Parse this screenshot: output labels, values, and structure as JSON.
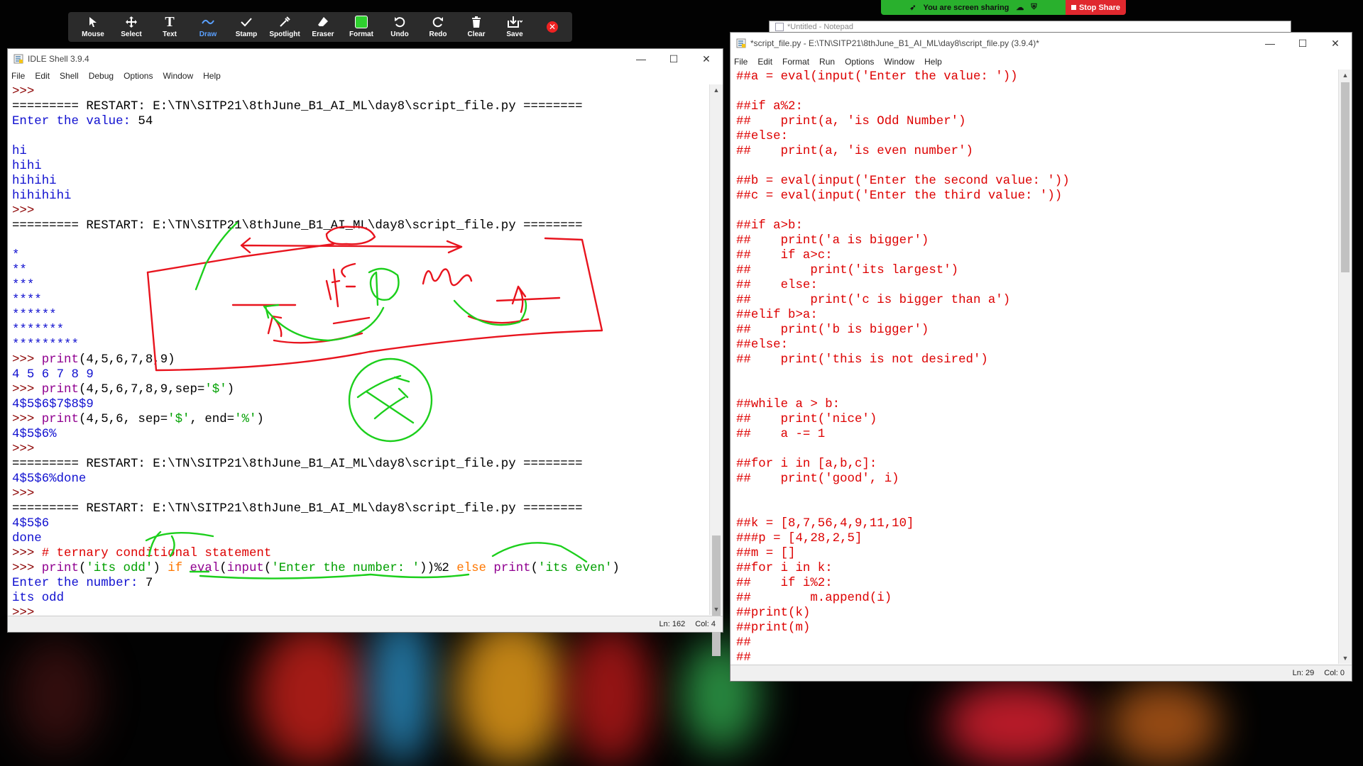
{
  "colors": {
    "shell_output": "#1010d0",
    "keyword": "#ff7700",
    "builtin": "#900090",
    "string": "#00a000",
    "comment": "#dd0000",
    "annotation_red": "#e8141e",
    "annotation_green": "#1ccf1c"
  },
  "zoom_toolbar": {
    "buttons": [
      {
        "label": "Mouse",
        "icon": "cursor-icon"
      },
      {
        "label": "Select",
        "icon": "move-icon"
      },
      {
        "label": "Text",
        "icon": "text-icon"
      },
      {
        "label": "Draw",
        "icon": "draw-icon",
        "active": true
      },
      {
        "label": "Stamp",
        "icon": "check-stamp-icon"
      },
      {
        "label": "Spotlight",
        "icon": "spotlight-icon"
      },
      {
        "label": "Eraser",
        "icon": "eraser-icon"
      },
      {
        "label": "Format",
        "icon": "format-icon"
      },
      {
        "label": "Undo",
        "icon": "undo-icon"
      },
      {
        "label": "Redo",
        "icon": "redo-icon"
      },
      {
        "label": "Clear",
        "icon": "trash-icon"
      },
      {
        "label": "Save",
        "icon": "save-icon"
      }
    ]
  },
  "share_banner": {
    "sharing_text": "You are screen sharing",
    "stop_label": "Stop Share"
  },
  "notepad_back": {
    "title": "*Untitled - Notepad"
  },
  "idle_shell": {
    "title": "IDLE Shell 3.9.4",
    "menu": [
      "File",
      "Edit",
      "Shell",
      "Debug",
      "Options",
      "Window",
      "Help"
    ],
    "status": {
      "line": "Ln: 162",
      "col": "Col: 4"
    },
    "lines": [
      [
        {
          "t": ">>>",
          "c": "c-prompt"
        }
      ],
      [
        {
          "t": "========= RESTART: E:\\TN\\SITP21\\8thJune_B1_AI_ML\\day8\\script_file.py ========",
          "c": ""
        }
      ],
      [
        {
          "t": "Enter the value: ",
          "c": "c-out"
        },
        {
          "t": "54",
          "c": ""
        }
      ],
      [],
      [
        {
          "t": "hi",
          "c": "c-out"
        }
      ],
      [
        {
          "t": "hihi",
          "c": "c-out"
        }
      ],
      [
        {
          "t": "hihihi",
          "c": "c-out"
        }
      ],
      [
        {
          "t": "hihihihi",
          "c": "c-out"
        }
      ],
      [
        {
          "t": ">>>",
          "c": "c-prompt"
        }
      ],
      [
        {
          "t": "========= RESTART: E:\\TN\\SITP21\\8thJune_B1_AI_ML\\day8\\script_file.py ========",
          "c": ""
        }
      ],
      [],
      [
        {
          "t": "*",
          "c": "c-out"
        }
      ],
      [
        {
          "t": "**",
          "c": "c-out"
        }
      ],
      [
        {
          "t": "***",
          "c": "c-out"
        }
      ],
      [
        {
          "t": "****",
          "c": "c-out"
        }
      ],
      [
        {
          "t": "******",
          "c": "c-out"
        }
      ],
      [
        {
          "t": "*******",
          "c": "c-out"
        }
      ],
      [
        {
          "t": "*********",
          "c": "c-out"
        }
      ],
      [
        {
          "t": ">>> ",
          "c": "c-prompt"
        },
        {
          "t": "print",
          "c": "c-bi"
        },
        {
          "t": "(4,5,6,7,8,9)",
          "c": ""
        }
      ],
      [
        {
          "t": "4 5 6 7 8 9",
          "c": "c-out"
        }
      ],
      [
        {
          "t": ">>> ",
          "c": "c-prompt"
        },
        {
          "t": "print",
          "c": "c-bi"
        },
        {
          "t": "(4,5,6,7,8,9,sep=",
          "c": ""
        },
        {
          "t": "'$'",
          "c": "c-str"
        },
        {
          "t": ")",
          "c": ""
        }
      ],
      [
        {
          "t": "4$5$6$7$8$9",
          "c": "c-out"
        }
      ],
      [
        {
          "t": ">>> ",
          "c": "c-prompt"
        },
        {
          "t": "print",
          "c": "c-bi"
        },
        {
          "t": "(4,5,6, sep=",
          "c": ""
        },
        {
          "t": "'$'",
          "c": "c-str"
        },
        {
          "t": ", end=",
          "c": ""
        },
        {
          "t": "'%'",
          "c": "c-str"
        },
        {
          "t": ")",
          "c": ""
        }
      ],
      [
        {
          "t": "4$5$6%",
          "c": "c-out"
        }
      ],
      [
        {
          "t": ">>>",
          "c": "c-prompt"
        }
      ],
      [
        {
          "t": "========= RESTART: E:\\TN\\SITP21\\8thJune_B1_AI_ML\\day8\\script_file.py ========",
          "c": ""
        }
      ],
      [
        {
          "t": "4$5$6%done",
          "c": "c-out"
        }
      ],
      [
        {
          "t": ">>>",
          "c": "c-prompt"
        }
      ],
      [
        {
          "t": "========= RESTART: E:\\TN\\SITP21\\8thJune_B1_AI_ML\\day8\\script_file.py ========",
          "c": ""
        }
      ],
      [
        {
          "t": "4$5$6",
          "c": "c-out"
        }
      ],
      [
        {
          "t": "done",
          "c": "c-out"
        }
      ],
      [
        {
          "t": ">>> ",
          "c": "c-prompt"
        },
        {
          "t": "# ternary conditional statement",
          "c": "c-cm"
        }
      ],
      [
        {
          "t": ">>> ",
          "c": "c-prompt"
        },
        {
          "t": "print",
          "c": "c-bi"
        },
        {
          "t": "(",
          "c": ""
        },
        {
          "t": "'its odd'",
          "c": "c-str"
        },
        {
          "t": ") ",
          "c": ""
        },
        {
          "t": "if",
          "c": "c-kw"
        },
        {
          "t": " ",
          "c": ""
        },
        {
          "t": "eval",
          "c": "c-bi"
        },
        {
          "t": "(",
          "c": ""
        },
        {
          "t": "input",
          "c": "c-bi"
        },
        {
          "t": "(",
          "c": ""
        },
        {
          "t": "'Enter the number: '",
          "c": "c-str"
        },
        {
          "t": "))%2 ",
          "c": ""
        },
        {
          "t": "else",
          "c": "c-kw"
        },
        {
          "t": " ",
          "c": ""
        },
        {
          "t": "print",
          "c": "c-bi"
        },
        {
          "t": "(",
          "c": ""
        },
        {
          "t": "'its even'",
          "c": "c-str"
        },
        {
          "t": ")",
          "c": ""
        }
      ],
      [
        {
          "t": "Enter the number: ",
          "c": "c-out"
        },
        {
          "t": "7",
          "c": ""
        }
      ],
      [
        {
          "t": "its odd",
          "c": "c-out"
        }
      ],
      [
        {
          "t": ">>> ",
          "c": "c-prompt"
        }
      ]
    ]
  },
  "script_editor": {
    "title": "*script_file.py - E:\\TN\\SITP21\\8thJune_B1_AI_ML\\day8\\script_file.py (3.9.4)*",
    "menu": [
      "File",
      "Edit",
      "Format",
      "Run",
      "Options",
      "Window",
      "Help"
    ],
    "status": {
      "line": "Ln: 29",
      "col": "Col: 0"
    },
    "lines": [
      "##a = eval(input('Enter the value: '))",
      "",
      "##if a%2:",
      "##    print(a, 'is Odd Number')",
      "##else:",
      "##    print(a, 'is even number')",
      "",
      "##b = eval(input('Enter the second value: '))",
      "##c = eval(input('Enter the third value: '))",
      "",
      "##if a>b:",
      "##    print('a is bigger')",
      "##    if a>c:",
      "##        print('its largest')",
      "##    else:",
      "##        print('c is bigger than a')",
      "##elif b>a:",
      "##    print('b is bigger')",
      "##else:",
      "##    print('this is not desired')",
      "",
      "",
      "##while a > b:",
      "##    print('nice')",
      "##    a -= 1",
      "",
      "##for i in [a,b,c]:",
      "##    print('good', i)",
      "",
      "",
      "##k = [8,7,56,4,9,11,10]",
      "###p = [4,28,2,5]",
      "##m = []",
      "##for i in k:",
      "##    if i%2:",
      "##        m.append(i)",
      "##print(k)",
      "##print(m)",
      "##",
      "##"
    ]
  }
}
